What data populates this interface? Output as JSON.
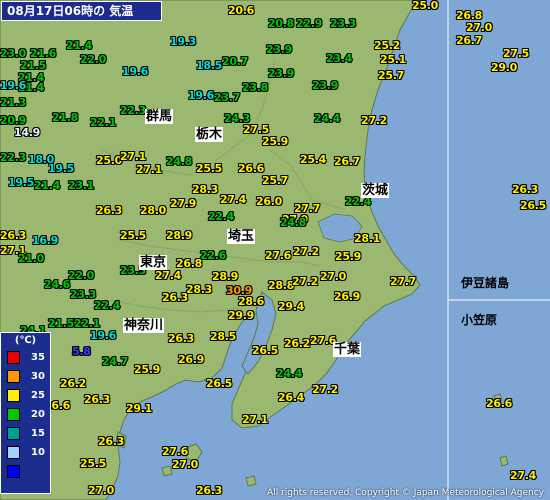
{
  "title": "08月17日06時の 気温",
  "copyright": "All rights reserved. Copyright © Japan Meteorological Agency",
  "legend": {
    "unit": "(℃)",
    "items": [
      {
        "label": "35",
        "color": "#e60000"
      },
      {
        "label": "30",
        "color": "#ff9900"
      },
      {
        "label": "25",
        "color": "#fff000"
      },
      {
        "label": "20",
        "color": "#00c800"
      },
      {
        "label": "15",
        "color": "#009e96"
      },
      {
        "label": "10",
        "color": "#a0d2ff"
      },
      {
        "label": "",
        "color": "#0000ff"
      }
    ]
  },
  "colors": {
    "sea": "#7fa7d6",
    "land": "#9ab870",
    "ring_25": "#fff000",
    "ring_20": "#00c800",
    "ring_15": "#009e96",
    "ring_10": "#a0d2ff",
    "ring_0": "#0000ff",
    "ring_30": "#ff9900"
  },
  "prefectures": [
    "群馬",
    "栃木",
    "茨城",
    "埼玉",
    "東京",
    "神奈川",
    "千葉"
  ],
  "regions": [
    "伊豆諸島",
    "小笠原"
  ],
  "observations": [
    {
      "v": "20.6",
      "c": "25"
    },
    {
      "v": "20.8",
      "c": "20"
    },
    {
      "v": "22.9",
      "c": "20"
    },
    {
      "v": "23.3",
      "c": "20"
    },
    {
      "v": "25.0",
      "c": "25"
    },
    {
      "v": "26.8",
      "c": "25"
    },
    {
      "v": "27.0",
      "c": "25"
    },
    {
      "v": "26.7",
      "c": "25"
    },
    {
      "v": "23.0",
      "c": "20"
    },
    {
      "v": "21.6",
      "c": "20"
    },
    {
      "v": "21.4",
      "c": "20"
    },
    {
      "v": "19.3",
      "c": "15"
    },
    {
      "v": "23.9",
      "c": "20"
    },
    {
      "v": "25.2",
      "c": "25"
    },
    {
      "v": "21.5",
      "c": "20"
    },
    {
      "v": "22.0",
      "c": "20"
    },
    {
      "v": "21.4",
      "c": "20"
    },
    {
      "v": "18.5",
      "c": "15"
    },
    {
      "v": "20.7",
      "c": "20"
    },
    {
      "v": "23.4",
      "c": "20"
    },
    {
      "v": "25.1",
      "c": "25"
    },
    {
      "v": "27.5",
      "c": "25"
    },
    {
      "v": "21.4",
      "c": "20"
    },
    {
      "v": "19.6",
      "c": "15"
    },
    {
      "v": "23.9",
      "c": "20"
    },
    {
      "v": "25.7",
      "c": "25"
    },
    {
      "v": "29.0",
      "c": "25"
    },
    {
      "v": "19.6",
      "c": "15"
    },
    {
      "v": "21.3",
      "c": "20"
    },
    {
      "v": "23.8",
      "c": "20"
    },
    {
      "v": "23.9",
      "c": "20"
    },
    {
      "v": "19.6",
      "c": "15"
    },
    {
      "v": "23.7",
      "c": "20"
    },
    {
      "v": "22.3",
      "c": "20"
    },
    {
      "v": "24.3",
      "c": "20"
    },
    {
      "v": "24.4",
      "c": "20"
    },
    {
      "v": "21.8",
      "c": "20"
    },
    {
      "v": "22.1",
      "c": "20"
    },
    {
      "v": "20.9",
      "c": "20"
    },
    {
      "v": "27.2",
      "c": "25"
    },
    {
      "v": "27.5",
      "c": "25"
    },
    {
      "v": "14.9",
      "c": "10"
    },
    {
      "v": "25.9",
      "c": "25"
    },
    {
      "v": "18.0",
      "c": "15"
    },
    {
      "v": "25.0",
      "c": "25"
    },
    {
      "v": "27.1",
      "c": "25"
    },
    {
      "v": "24.8",
      "c": "20"
    },
    {
      "v": "25.4",
      "c": "25"
    },
    {
      "v": "26.7",
      "c": "25"
    },
    {
      "v": "22.3",
      "c": "20"
    },
    {
      "v": "19.5",
      "c": "15"
    },
    {
      "v": "27.1",
      "c": "25"
    },
    {
      "v": "25.5",
      "c": "25"
    },
    {
      "v": "26.6",
      "c": "25"
    },
    {
      "v": "19.5",
      "c": "15"
    },
    {
      "v": "21.4",
      "c": "20"
    },
    {
      "v": "23.1",
      "c": "20"
    },
    {
      "v": "25.7",
      "c": "25"
    },
    {
      "v": "28.3",
      "c": "25"
    },
    {
      "v": "26.3",
      "c": "25"
    },
    {
      "v": "27.9",
      "c": "25"
    },
    {
      "v": "26.5",
      "c": "25"
    },
    {
      "v": "27.4",
      "c": "25"
    },
    {
      "v": "26.0",
      "c": "25"
    },
    {
      "v": "22.4",
      "c": "20"
    },
    {
      "v": "26.3",
      "c": "25"
    },
    {
      "v": "27.9",
      "c": "25"
    },
    {
      "v": "28.0",
      "c": "25"
    },
    {
      "v": "27.7",
      "c": "25"
    },
    {
      "v": "22.4",
      "c": "20"
    },
    {
      "v": "26.3",
      "c": "25"
    },
    {
      "v": "24.8",
      "c": "20"
    },
    {
      "v": "25.5",
      "c": "25"
    },
    {
      "v": "28.9",
      "c": "25"
    },
    {
      "v": "27.1",
      "c": "25"
    },
    {
      "v": "16.9",
      "c": "15"
    },
    {
      "v": "22.6",
      "c": "20"
    },
    {
      "v": "28.1",
      "c": "25"
    },
    {
      "v": "27.6",
      "c": "25"
    },
    {
      "v": "27.2",
      "c": "25"
    },
    {
      "v": "25.9",
      "c": "25"
    },
    {
      "v": "21.0",
      "c": "20"
    },
    {
      "v": "26.8",
      "c": "25"
    },
    {
      "v": "23.5",
      "c": "20"
    },
    {
      "v": "27.4",
      "c": "25"
    },
    {
      "v": "27.7",
      "c": "25"
    },
    {
      "v": "28.9",
      "c": "25"
    },
    {
      "v": "22.0",
      "c": "20"
    },
    {
      "v": "24.6",
      "c": "20"
    },
    {
      "v": "28.8",
      "c": "25"
    },
    {
      "v": "27.2",
      "c": "25"
    },
    {
      "v": "27.0",
      "c": "25"
    },
    {
      "v": "28.3",
      "c": "25"
    },
    {
      "v": "30.9",
      "c": "30"
    },
    {
      "v": "26.9",
      "c": "25"
    },
    {
      "v": "23.3",
      "c": "20"
    },
    {
      "v": "26.3",
      "c": "25"
    },
    {
      "v": "28.6",
      "c": "25"
    },
    {
      "v": "29.4",
      "c": "25"
    },
    {
      "v": "22.4",
      "c": "20"
    },
    {
      "v": "29.9",
      "c": "25"
    },
    {
      "v": "21.5",
      "c": "20"
    },
    {
      "v": "22.1",
      "c": "20"
    },
    {
      "v": "24.1",
      "c": "20"
    },
    {
      "v": "19.6",
      "c": "15"
    },
    {
      "v": "26.3",
      "c": "25"
    },
    {
      "v": "28.5",
      "c": "25"
    },
    {
      "v": "26.2",
      "c": "25"
    },
    {
      "v": "27.6",
      "c": "25"
    },
    {
      "v": "5.8",
      "c": "0"
    },
    {
      "v": "26.5",
      "c": "25"
    },
    {
      "v": "24.7",
      "c": "20"
    },
    {
      "v": "26.9",
      "c": "25"
    },
    {
      "v": "25.9",
      "c": "25"
    },
    {
      "v": "24.4",
      "c": "20"
    },
    {
      "v": "26.2",
      "c": "25"
    },
    {
      "v": "26.5",
      "c": "25"
    },
    {
      "v": "23.0",
      "c": "20"
    },
    {
      "v": "27.2",
      "c": "25"
    },
    {
      "v": "26.4",
      "c": "25"
    },
    {
      "v": "26.3",
      "c": "25"
    },
    {
      "v": "26.6",
      "c": "25"
    },
    {
      "v": "29.1",
      "c": "25"
    },
    {
      "v": "27.1",
      "c": "25"
    },
    {
      "v": "27.6",
      "c": "25"
    },
    {
      "v": "26.3",
      "c": "25"
    },
    {
      "v": "25.5",
      "c": "25"
    },
    {
      "v": "27.0",
      "c": "25"
    },
    {
      "v": "27.0",
      "c": "25"
    },
    {
      "v": "26.3",
      "c": "25"
    },
    {
      "v": "27.4",
      "c": "25"
    },
    {
      "v": "26.6",
      "c": "25"
    }
  ]
}
